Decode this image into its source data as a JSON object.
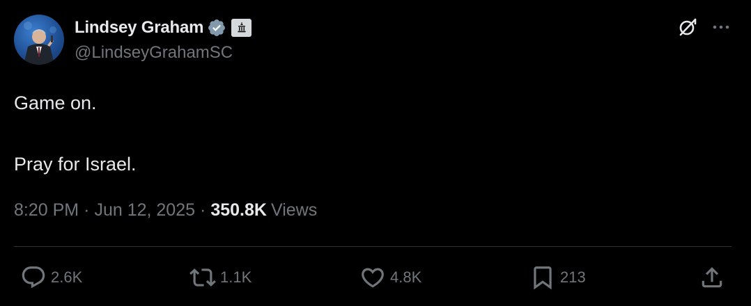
{
  "author": {
    "display_name": "Lindsey Graham",
    "handle": "@LindseyGrahamSC",
    "verified": true,
    "affiliation_badge": "government-building-icon"
  },
  "post": {
    "lines": [
      "Game on.",
      "Pray for Israel."
    ]
  },
  "meta": {
    "time": "8:20 PM",
    "separator": "·",
    "date": "Jun 12, 2025",
    "views_count": "350.8K",
    "views_label": "Views"
  },
  "actions": {
    "replies": "2.6K",
    "reposts": "1.1K",
    "likes": "4.8K",
    "bookmarks": "213"
  },
  "icons": {
    "top_right": [
      "grok-icon",
      "more-icon"
    ],
    "actions": [
      "reply-icon",
      "repost-icon",
      "like-icon",
      "bookmark-icon",
      "share-icon"
    ]
  },
  "colors": {
    "background": "#000000",
    "primary_text": "#e7e9ea",
    "secondary_text": "#71767b",
    "verified_badge": "#829aab",
    "divider": "#2f3336"
  }
}
